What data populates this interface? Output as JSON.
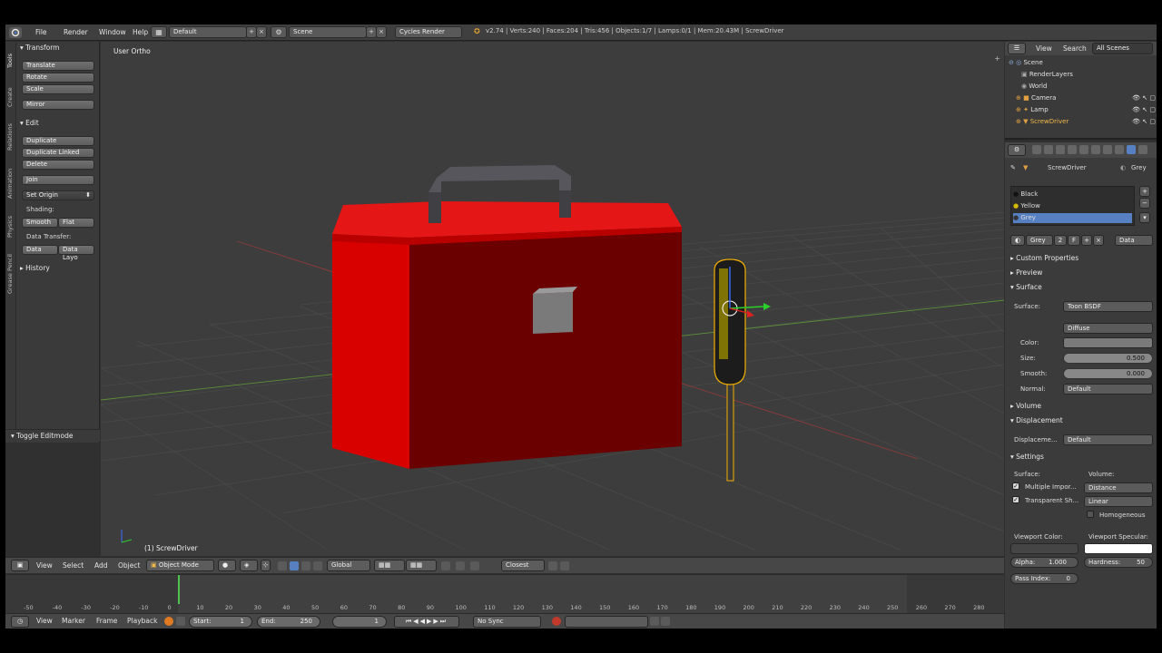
{
  "topbar": {
    "menus": [
      "File",
      "Render",
      "Window",
      "Help"
    ],
    "layout": "Default",
    "scene": "Scene",
    "engine": "Cycles Render",
    "stats": "v2.74 | Verts:240 | Faces:204 | Tris:456 | Objects:1/7 | Lamps:0/1 | Mem:20.43M | ScrewDriver"
  },
  "toolshelf": {
    "tabs": [
      "Tools",
      "Create",
      "Relations",
      "Animation",
      "Physics",
      "Grease Pencil"
    ],
    "transform_header": "Transform",
    "transform": [
      "Translate",
      "Rotate",
      "Scale"
    ],
    "mirror": "Mirror",
    "edit_header": "Edit",
    "edit": [
      "Duplicate",
      "Duplicate Linked",
      "Delete"
    ],
    "join": "Join",
    "set_origin": "Set Origin",
    "shading_label": "Shading:",
    "smooth": "Smooth",
    "flat": "Flat",
    "data_transfer_label": "Data Transfer:",
    "data": "Data",
    "data_layout": "Data Layo",
    "history": "History",
    "toggle_editmode": "Toggle Editmode"
  },
  "viewport": {
    "view_label": "User Ortho",
    "object_label": "(1) ScrewDriver",
    "colors": {
      "box_front": "#6b0000",
      "box_side": "#cc0000",
      "box_top": "#e01515",
      "handle": "#4a4a4f",
      "latch": "#7d7d7d",
      "screwdriver": "#e8c400"
    }
  },
  "viewheader": {
    "menus": [
      "View",
      "Select",
      "Add",
      "Object"
    ],
    "mode": "Object Mode",
    "orientation": "Global",
    "snap": "Closest"
  },
  "timeline": {
    "ticks": [
      "-50",
      "-40",
      "-30",
      "-20",
      "-10",
      "0",
      "10",
      "20",
      "30",
      "40",
      "50",
      "60",
      "70",
      "80",
      "90",
      "100",
      "110",
      "120",
      "130",
      "140",
      "150",
      "160",
      "170",
      "180",
      "190",
      "200",
      "210",
      "220",
      "230",
      "240",
      "250",
      "260",
      "270",
      "280"
    ],
    "menus": [
      "View",
      "Marker",
      "Frame",
      "Playback"
    ],
    "start_label": "Start:",
    "start_value": "1",
    "end_label": "End:",
    "end_value": "250",
    "current_frame": "1",
    "sync": "No Sync"
  },
  "outliner": {
    "header": [
      "View",
      "Search",
      "All Scenes"
    ],
    "items": [
      "Scene",
      "RenderLayers",
      "World",
      "Camera",
      "Lamp",
      "ScrewDriver"
    ]
  },
  "properties": {
    "breadcrumb_object": "ScrewDriver",
    "breadcrumb_material": "Grey",
    "materials": [
      "Black",
      "Yellow",
      "Grey"
    ],
    "material_name": "Grey",
    "material_users": "2",
    "fake_user": "F",
    "link": "Data",
    "sections": {
      "custom_properties": "Custom Properties",
      "preview": "Preview",
      "surface": "Surface",
      "volume": "Volume",
      "displacement": "Displacement",
      "settings": "Settings"
    },
    "surface_label": "Surface:",
    "surface_value": "Toon BSDF",
    "component": "Diffuse",
    "color_label": "Color:",
    "size_label": "Size:",
    "size_value": "0.500",
    "smooth_label": "Smooth:",
    "smooth_value": "0.000",
    "normal_label": "Normal:",
    "normal_value": "Default",
    "displacement_label": "Displaceme...",
    "displacement_value": "Default",
    "settings_surface": "Surface:",
    "settings_volume": "Volume:",
    "multiple_importance": "Multiple Impor...",
    "transparent_shadows": "Transparent Sh...",
    "volume_sampling": "Distance",
    "volume_interp": "Linear",
    "homogeneous": "Homogeneous",
    "viewport_color": "Viewport Color:",
    "viewport_specular": "Viewport Specular:",
    "alpha_label": "Alpha:",
    "alpha_value": "1.000",
    "hardness_label": "Hardness:",
    "hardness_value": "50",
    "pass_index_label": "Pass Index:",
    "pass_index_value": "0"
  }
}
